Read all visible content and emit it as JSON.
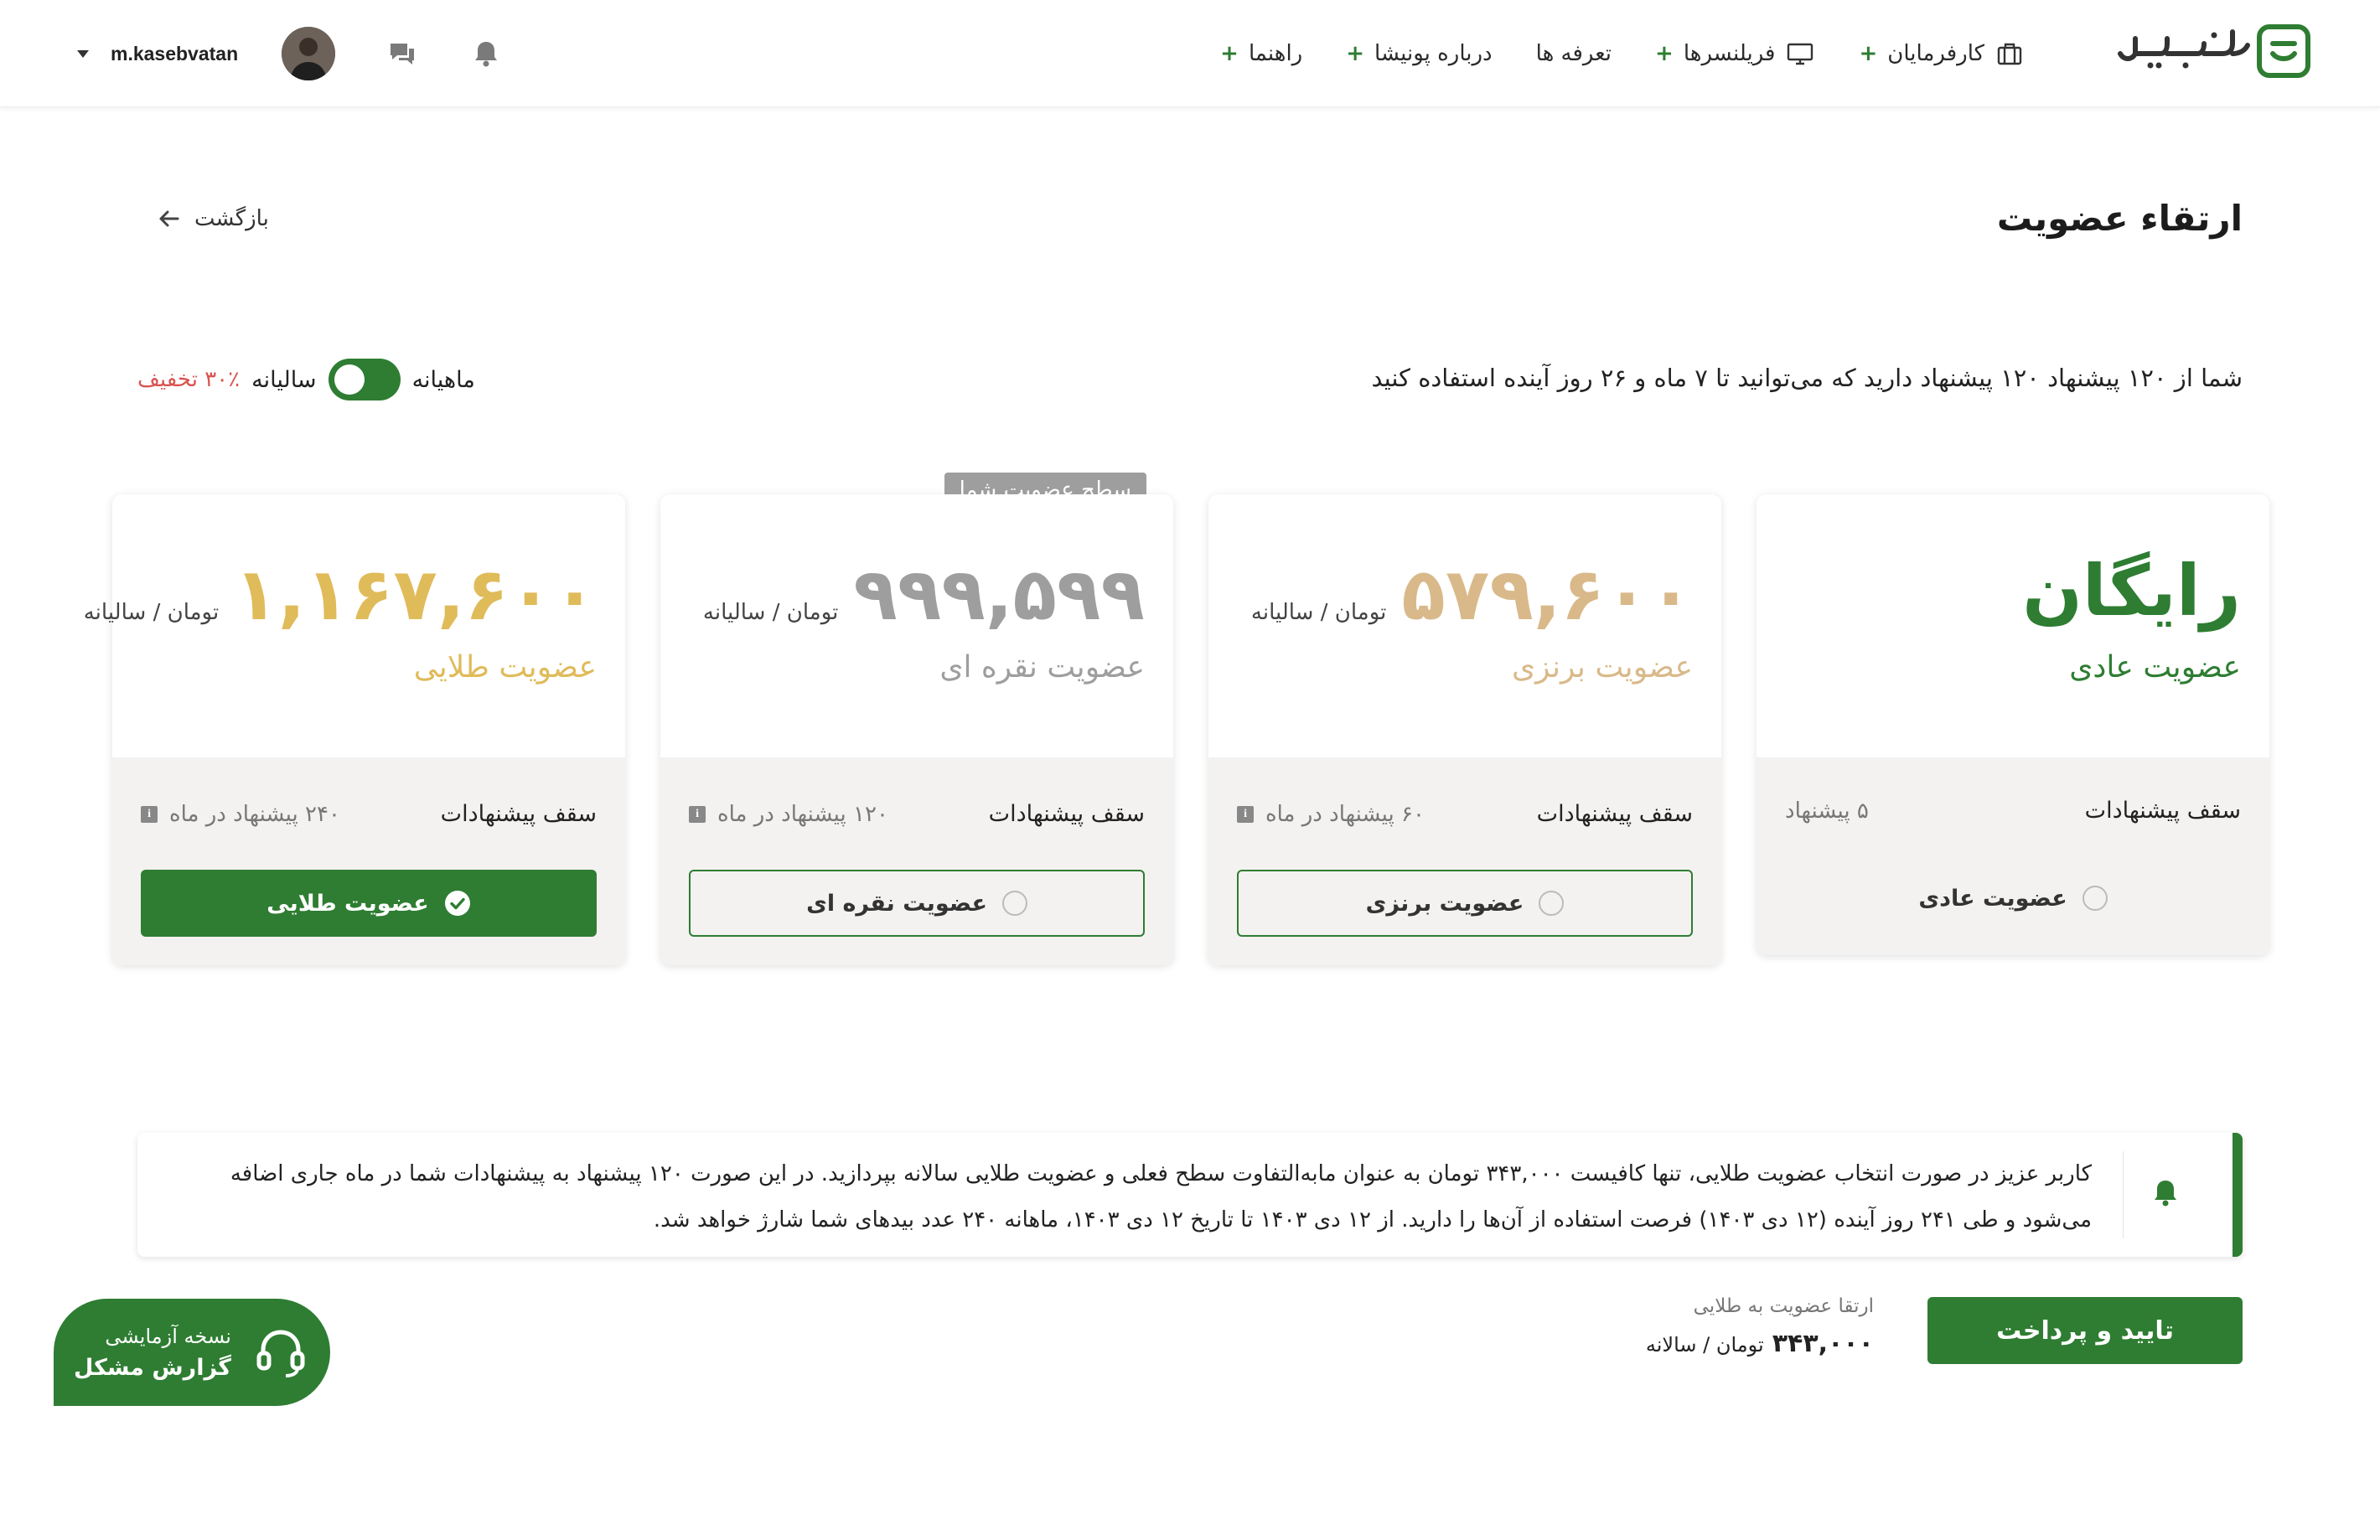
{
  "header": {
    "nav": [
      {
        "label": "کارفرمایان",
        "icon": "briefcase-icon"
      },
      {
        "label": "فریلنسرها",
        "icon": "monitor-icon"
      },
      {
        "label": "تعرفه ها",
        "icon": ""
      },
      {
        "label": "درباره پونیشا",
        "icon": ""
      },
      {
        "label": "راهنما",
        "icon": ""
      }
    ],
    "plus": "+",
    "username": "m.kasebvatan"
  },
  "page": {
    "title": "ارتقاء عضویت",
    "back": "بازگشت",
    "quota_text": "شما از ۱۲۰ پیشنهاد ۱۲۰ پیشنهاد دارید که می‌توانید تا ۷ ماه و ۲۶ روز آینده استفاده کنید"
  },
  "billing": {
    "monthly": "ماهیانه",
    "yearly": "سالیانه",
    "discount": "۳۰٪ تخفیف",
    "yearly_selected": true
  },
  "cards": [
    {
      "price": "رایگان",
      "unit": "",
      "name": "عضویت عادی",
      "cap_label": "سقف پیشنهادات",
      "cap_value": "۵ پیشنهاد",
      "button": "عضویت عادی",
      "selected": false,
      "color": "#2e7d32"
    },
    {
      "price": "۵۷۹,۶۰۰",
      "unit": "تومان / سالیانه",
      "name": "عضویت برنزی",
      "cap_label": "سقف پیشنهادات",
      "cap_value": "۶۰ پیشنهاد در ماه",
      "button": "عضویت برنزی",
      "selected": false,
      "color": "#d9b98a"
    },
    {
      "price": "۹۹۹,۵۹۹",
      "unit": "تومان / سالیانه",
      "name": "عضویت نقره ای",
      "cap_label": "سقف پیشنهادات",
      "cap_value": "۱۲۰ پیشنهاد در ماه",
      "button": "عضویت نقره ای",
      "selected": false,
      "badge": "سطح عضویت شما",
      "color": "#9e9e9e"
    },
    {
      "price": "۱,۱۶۷,۶۰۰",
      "unit": "تومان / سالیانه",
      "name": "عضویت طلایی",
      "cap_label": "سقف پیشنهادات",
      "cap_value": "۲۴۰ پیشنهاد در ماه",
      "button": "عضویت طلایی",
      "selected": true,
      "color": "#e0bb5a"
    }
  ],
  "notice": {
    "line1": "کاربر عزیز در صورت انتخاب عضویت طلایی، تنها کافیست ۳۴۳,۰۰۰ تومان به عنوان مابه‌التفاوت سطح فعلی و عضویت طلایی سالانه بپردازید. در این صورت ۱۲۰ پیشنهاد به پیشنهادات شما در ماه جاری اضافه",
    "line2": "می‌شود و طی ۲۴۱ روز آینده (۱۲ دی ۱۴۰۳) فرصت استفاده از آن‌ها را دارید. از ۱۲ دی ۱۴۰۳ تا تاریخ ۱۲ دی ۱۴۰۳، ماهانه ۲۴۰ عدد بیدهای شما شارژ خواهد شد."
  },
  "footer": {
    "pay_button": "تایید و پرداخت",
    "summary_title": "ارتقا عضویت به طلایی",
    "summary_amount": "۳۴۳,۰۰۰",
    "summary_unit": "تومان / سالانه"
  },
  "support": {
    "line1": "نسخه آزمایشی",
    "line2": "گزارش مشکل"
  },
  "colors": {
    "brand": "#2e7d32",
    "bronze": "#d9b98a",
    "silver": "#9e9e9e",
    "gold": "#e0bb5a",
    "discount": "#d9534f"
  }
}
